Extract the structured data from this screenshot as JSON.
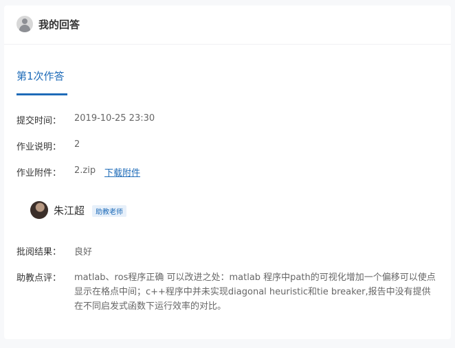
{
  "header": {
    "title": "我的回答"
  },
  "tab": {
    "label": "第1次作答"
  },
  "submission": {
    "time_label": "提交时间：",
    "time_value": "2019-10-25 23:30",
    "desc_label": "作业说明：",
    "desc_value": "2",
    "attach_label": "作业附件：",
    "attach_file": "2.zip",
    "attach_link": "下载附件"
  },
  "teacher": {
    "name": "朱江超",
    "role": "助教老师"
  },
  "review": {
    "result_label": "批阅结果：",
    "result_value": "良好",
    "comment_label": "助教点评：",
    "comment_value": "matlab、ros程序正确 可以改进之处：matlab 程序中path的可视化增加一个偏移可以使点显示在格点中间；c++程序中并未实现diagonal heuristic和tie breaker,报告中没有提供在不同启发式函数下运行效率的对比。"
  }
}
